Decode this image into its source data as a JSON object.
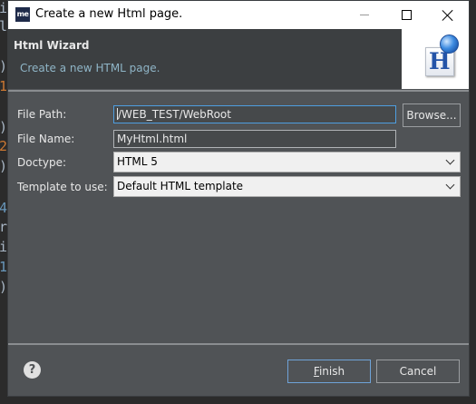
{
  "window": {
    "title": "Create a new Html page.",
    "app_icon_label": "me"
  },
  "wizard": {
    "title": "Html Wizard",
    "description": "Create a new HTML page.",
    "banner_letter": "H"
  },
  "form": {
    "file_path": {
      "label": "File Path:",
      "value": "/WEB_TEST/WebRoot"
    },
    "browse_label": "Browse...",
    "file_name": {
      "label": "File Name:",
      "value": "MyHtml.html"
    },
    "doctype": {
      "label": "Doctype:",
      "selected": "HTML 5"
    },
    "template": {
      "label": "Template to use:",
      "selected": "Default HTML template"
    }
  },
  "footer": {
    "help_glyph": "?",
    "finish_label": {
      "mnemonic": "F",
      "rest": "inish"
    },
    "cancel_label": "Cancel"
  },
  "editor_glyphs": [
    {
      "char": "i",
      "color": "#a9b7c6"
    },
    {
      "char": "l",
      "color": "#a9b7c6"
    },
    {
      "char": ")",
      "color": "#a9b7c6"
    },
    {
      "char": "1",
      "color": "#cc7832"
    },
    {
      "char": ")",
      "color": "#a9b7c6"
    },
    {
      "char": "2",
      "color": "#cc7832"
    },
    {
      "char": ")",
      "color": "#a9b7c6"
    },
    {
      "char": "4",
      "color": "#6897bb"
    },
    {
      "char": "r",
      "color": "#a9b7c6"
    },
    {
      "char": "i",
      "color": "#a9b7c6"
    },
    {
      "char": "1",
      "color": "#6897bb"
    },
    {
      "char": ")",
      "color": "#a9b7c6"
    }
  ]
}
